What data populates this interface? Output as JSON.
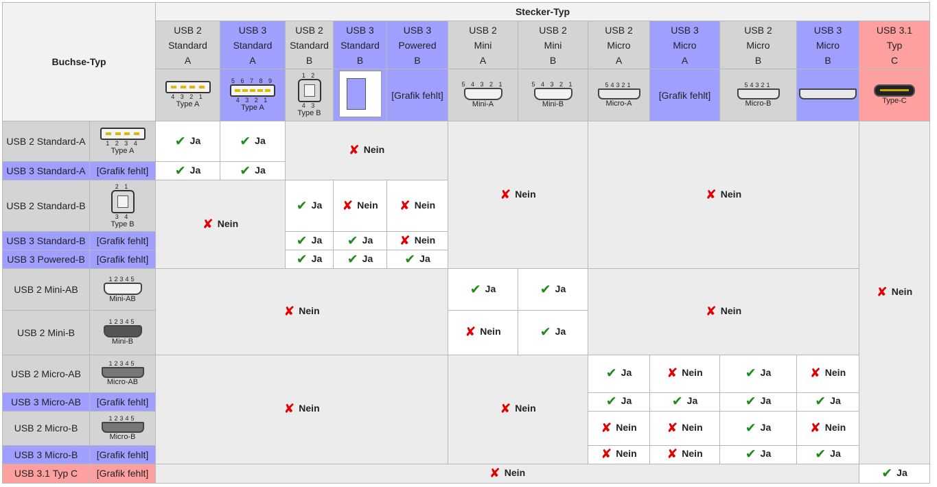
{
  "table": {
    "corner_label": "Buchse-Typ",
    "stecker_label": "Stecker-Typ",
    "columns": [
      {
        "lines": [
          "USB 2",
          "Standard",
          "A"
        ],
        "color": "#d4d4d4",
        "caption": "Type A",
        "pins": "4  3  2  1",
        "image": "usb-a-plug-icon"
      },
      {
        "lines": [
          "USB 3",
          "Standard",
          "A"
        ],
        "color": "#9f9fff",
        "caption": "Type A",
        "pins_top": "5 6 7 8 9",
        "pins": "4  3  2  1",
        "image": "usb3-a-plug-icon"
      },
      {
        "lines": [
          "USB 2",
          "Standard",
          "B"
        ],
        "color": "#d4d4d4",
        "caption": "Type B",
        "pins_top": "1  2",
        "pins": "4  3",
        "image": "usb-b-plug-icon"
      },
      {
        "lines": [
          "USB 3",
          "Standard",
          "B"
        ],
        "color": "#9f9fff",
        "image": "usb3-b-drawing-icon"
      },
      {
        "lines": [
          "USB 3",
          "Powered",
          "B"
        ],
        "color": "#9f9fff",
        "missing": "[Grafik fehlt]"
      },
      {
        "lines": [
          "USB 2",
          "Mini",
          "A"
        ],
        "color": "#d4d4d4",
        "caption": "Mini-A",
        "pins_top": "5 4 3 2 1",
        "image": "mini-a-plug-icon"
      },
      {
        "lines": [
          "USB 2",
          "Mini",
          "B"
        ],
        "color": "#d4d4d4",
        "caption": "Mini-B",
        "pins_top": "5 4 3 2 1",
        "image": "mini-b-plug-icon"
      },
      {
        "lines": [
          "USB 2",
          "Micro",
          "A"
        ],
        "color": "#d4d4d4",
        "caption": "Micro-A",
        "pins_top": "54321",
        "image": "micro-a-plug-icon"
      },
      {
        "lines": [
          "USB 3",
          "Micro",
          "A"
        ],
        "color": "#9f9fff",
        "missing": "[Grafik fehlt]"
      },
      {
        "lines": [
          "USB 2",
          "Micro",
          "B"
        ],
        "color": "#d4d4d4",
        "caption": "Micro-B",
        "pins_top": "54321",
        "image": "micro-b-plug-icon"
      },
      {
        "lines": [
          "USB 3",
          "Micro",
          "B"
        ],
        "color": "#9f9fff",
        "image": "usb3-micro-b-plug-icon"
      },
      {
        "lines": [
          "USB 3.1",
          "Typ",
          "C"
        ],
        "color": "#ffa0a0",
        "caption": "Type-C",
        "image": "type-c-plug-icon"
      }
    ],
    "rows": [
      {
        "label": "USB 2 Standard-A",
        "color": "#d4d4d4",
        "image": "usb-a-socket-icon",
        "caption": "Type A",
        "pins": "1  2  3  4"
      },
      {
        "label": "USB 3 Standard-A",
        "color": "#9f9fff",
        "missing": "[Grafik fehlt]"
      },
      {
        "label": "USB 2 Standard-B",
        "color": "#d4d4d4",
        "image": "usb-b-socket-icon",
        "caption": "Type B",
        "pins_top": "2  1",
        "pins": "3  4"
      },
      {
        "label": "USB 3 Standard-B",
        "color": "#9f9fff",
        "missing": "[Grafik fehlt]"
      },
      {
        "label": "USB 3 Powered-B",
        "color": "#9f9fff",
        "missing": "[Grafik fehlt]"
      },
      {
        "label": "USB 2 Mini-AB",
        "color": "#d4d4d4",
        "image": "mini-ab-socket-icon",
        "caption": "Mini-AB",
        "pins_top": "12345"
      },
      {
        "label": "USB 2 Mini-B",
        "color": "#d4d4d4",
        "image": "mini-b-socket-icon",
        "caption": "Mini-B",
        "pins_top": "12345"
      },
      {
        "label": "USB 2 Micro-AB",
        "color": "#d4d4d4",
        "image": "micro-ab-socket-icon",
        "caption": "Micro-AB",
        "pins_top": "12345"
      },
      {
        "label": "USB 3 Micro-AB",
        "color": "#9f9fff",
        "missing": "[Grafik fehlt]"
      },
      {
        "label": "USB 2 Micro-B",
        "color": "#d4d4d4",
        "image": "micro-b-socket-icon",
        "caption": "Micro-B",
        "pins_top": "12345"
      },
      {
        "label": "USB 3 Micro-B",
        "color": "#9f9fff",
        "missing": "[Grafik fehlt]"
      },
      {
        "label": "USB 3.1 Typ C",
        "color": "#ffa0a0",
        "missing": "[Grafik fehlt]"
      }
    ],
    "values": {
      "yes": "Ja",
      "no": "Nein"
    },
    "cells": [
      {
        "r": 0,
        "c": 0,
        "v": "Ja"
      },
      {
        "r": 0,
        "c": 1,
        "v": "Ja"
      },
      {
        "r": 0,
        "c": 2,
        "rs": 2,
        "cs": 3,
        "v": "Nein"
      },
      {
        "r": 0,
        "c": 5,
        "rs": 5,
        "cs": 2,
        "v": "Nein"
      },
      {
        "r": 0,
        "c": 7,
        "rs": 5,
        "cs": 4,
        "v": "Nein"
      },
      {
        "r": 0,
        "c": 11,
        "rs": 11,
        "v": "Nein"
      },
      {
        "r": 1,
        "c": 0,
        "v": "Ja"
      },
      {
        "r": 1,
        "c": 1,
        "v": "Ja"
      },
      {
        "r": 2,
        "c": 0,
        "rs": 3,
        "cs": 2,
        "v": "Nein"
      },
      {
        "r": 2,
        "c": 2,
        "v": "Ja"
      },
      {
        "r": 2,
        "c": 3,
        "v": "Nein"
      },
      {
        "r": 2,
        "c": 4,
        "v": "Nein"
      },
      {
        "r": 3,
        "c": 2,
        "v": "Ja"
      },
      {
        "r": 3,
        "c": 3,
        "v": "Ja"
      },
      {
        "r": 3,
        "c": 4,
        "v": "Nein"
      },
      {
        "r": 4,
        "c": 2,
        "v": "Ja"
      },
      {
        "r": 4,
        "c": 3,
        "v": "Ja"
      },
      {
        "r": 4,
        "c": 4,
        "v": "Ja"
      },
      {
        "r": 5,
        "c": 0,
        "rs": 2,
        "cs": 5,
        "v": "Nein"
      },
      {
        "r": 5,
        "c": 5,
        "v": "Ja"
      },
      {
        "r": 5,
        "c": 6,
        "v": "Ja"
      },
      {
        "r": 5,
        "c": 7,
        "rs": 2,
        "cs": 4,
        "v": "Nein"
      },
      {
        "r": 6,
        "c": 5,
        "v": "Nein"
      },
      {
        "r": 6,
        "c": 6,
        "v": "Ja"
      },
      {
        "r": 7,
        "c": 0,
        "rs": 4,
        "cs": 5,
        "v": "Nein"
      },
      {
        "r": 7,
        "c": 5,
        "rs": 4,
        "cs": 2,
        "v": "Nein"
      },
      {
        "r": 7,
        "c": 7,
        "v": "Ja"
      },
      {
        "r": 7,
        "c": 8,
        "v": "Nein"
      },
      {
        "r": 7,
        "c": 9,
        "v": "Ja"
      },
      {
        "r": 7,
        "c": 10,
        "v": "Nein"
      },
      {
        "r": 8,
        "c": 7,
        "v": "Ja"
      },
      {
        "r": 8,
        "c": 8,
        "v": "Ja"
      },
      {
        "r": 8,
        "c": 9,
        "v": "Ja"
      },
      {
        "r": 8,
        "c": 10,
        "v": "Ja"
      },
      {
        "r": 9,
        "c": 7,
        "v": "Nein"
      },
      {
        "r": 9,
        "c": 8,
        "v": "Nein"
      },
      {
        "r": 9,
        "c": 9,
        "v": "Ja"
      },
      {
        "r": 9,
        "c": 10,
        "v": "Nein"
      },
      {
        "r": 10,
        "c": 7,
        "v": "Nein"
      },
      {
        "r": 10,
        "c": 8,
        "v": "Nein"
      },
      {
        "r": 10,
        "c": 9,
        "v": "Ja"
      },
      {
        "r": 10,
        "c": 10,
        "v": "Ja"
      },
      {
        "r": 11,
        "c": 0,
        "cs": 11,
        "v": "Nein"
      },
      {
        "r": 11,
        "c": 11,
        "v": "Ja"
      }
    ]
  }
}
